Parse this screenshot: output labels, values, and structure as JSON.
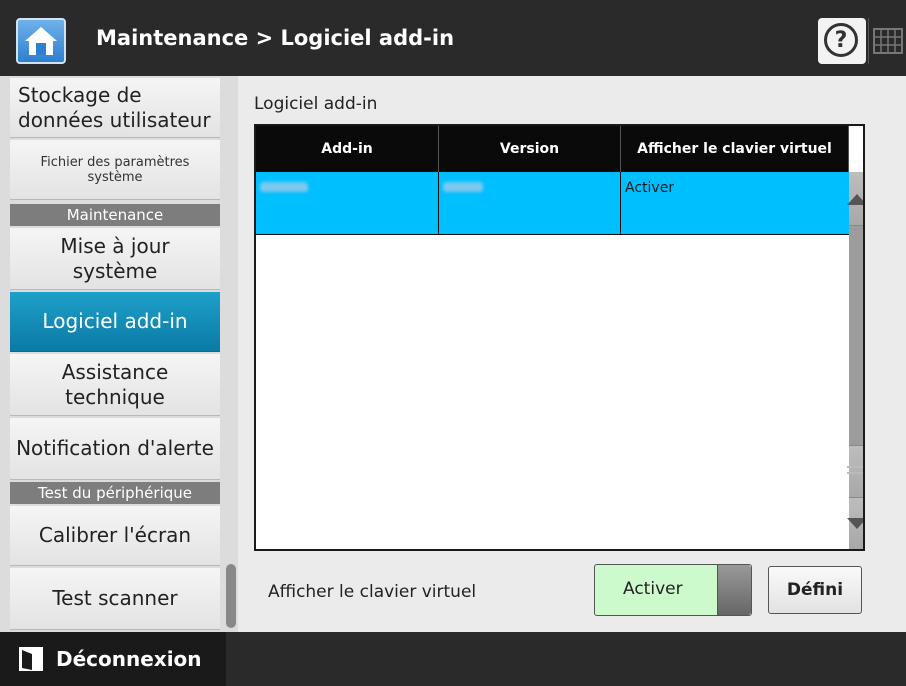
{
  "header": {
    "title": "Maintenance > Logiciel add-in",
    "help_symbol": "?"
  },
  "sidebar": {
    "items": [
      {
        "label": "Stockage de données utilisateur"
      },
      {
        "label": "Fichier des paramètres système"
      },
      {
        "section": "Maintenance"
      },
      {
        "label": "Mise à jour système"
      },
      {
        "label": "Logiciel add-in",
        "active": true
      },
      {
        "label": "Assistance technique"
      },
      {
        "label": "Notification d'alerte"
      },
      {
        "section": "Test du périphérique"
      },
      {
        "label": "Calibrer l'écran"
      },
      {
        "label": "Test scanner"
      }
    ]
  },
  "main": {
    "section_title": "Logiciel add-in",
    "table": {
      "columns": [
        "Add-in",
        "Version",
        "Afficher le clavier virtuel"
      ],
      "rows": [
        {
          "addin": "",
          "version": "",
          "keyboard": "Activer",
          "selected": true
        }
      ]
    },
    "keyboard_label": "Afficher le clavier virtuel",
    "toggle_value": "Activer",
    "set_button": "Défini"
  },
  "footer": {
    "logout_label": "Déconnexion"
  },
  "colors": {
    "selected_row": "#00bfff",
    "active_sidebar": "#0a7aa6",
    "toggle_on": "#cdfacd"
  }
}
